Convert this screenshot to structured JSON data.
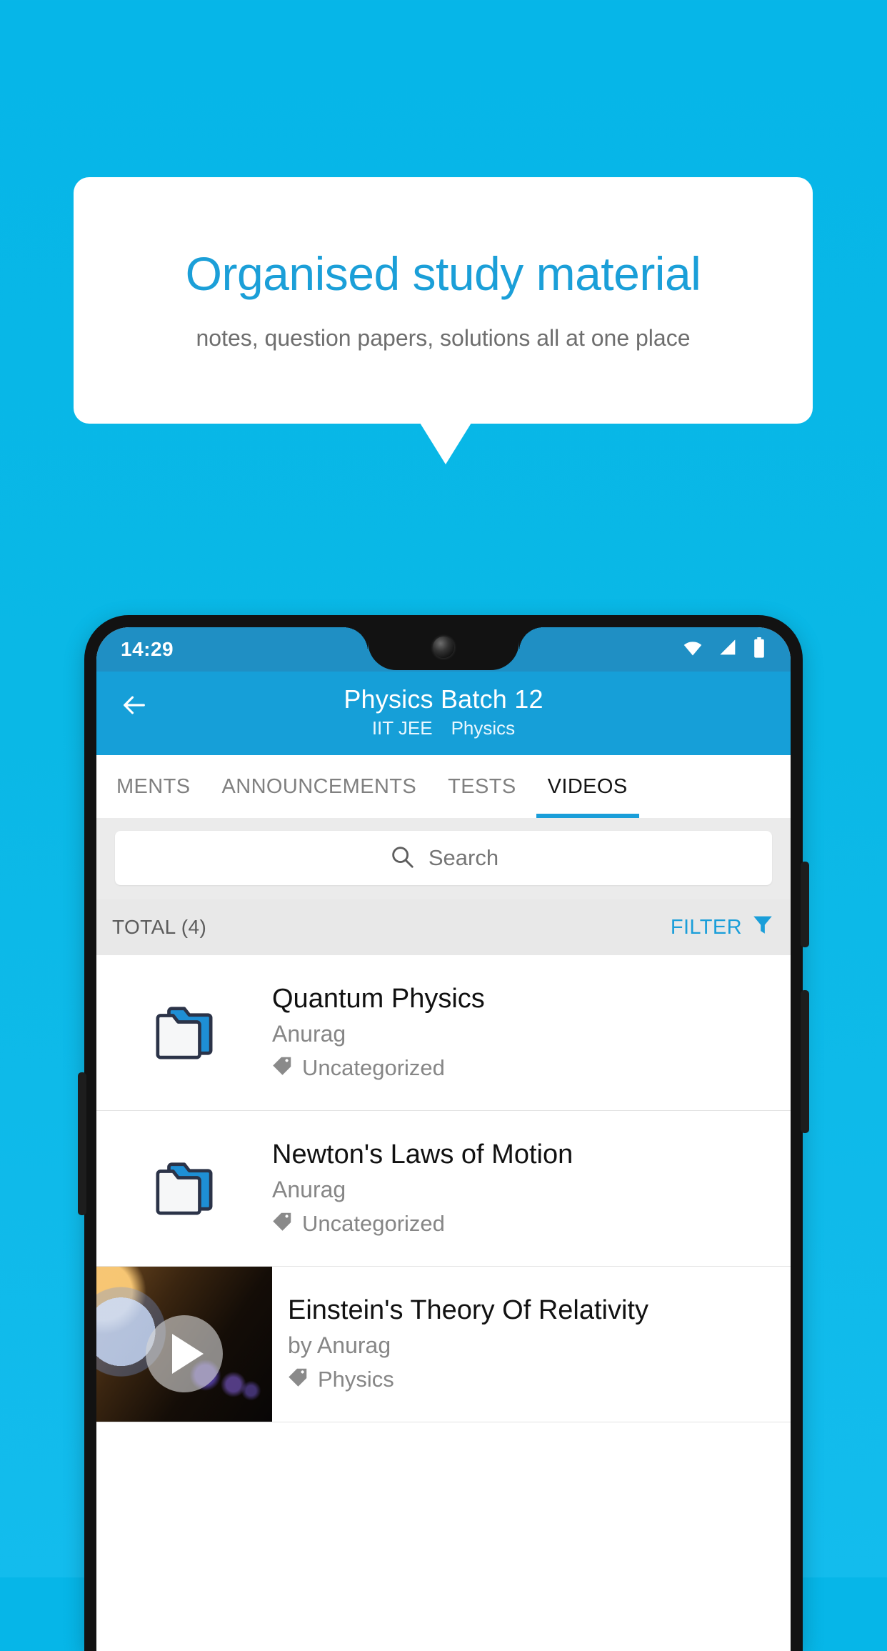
{
  "promo": {
    "title": "Organised study material",
    "subtitle": "notes, question papers, solutions all at one place",
    "accent_color": "#1b9fd8",
    "background_color": "#0ab8e6"
  },
  "phone": {
    "status_bar": {
      "time": "14:29",
      "icons": [
        "wifi-icon",
        "signal-icon",
        "battery-icon"
      ],
      "background_color": "#1f8fc4"
    },
    "app_bar": {
      "back_icon": "back-arrow-icon",
      "title": "Physics Batch 12",
      "subtitle_exam": "IIT JEE",
      "subtitle_subject": "Physics",
      "background_color": "#169fd8"
    },
    "tabs": [
      {
        "label": "MENTS",
        "active": false
      },
      {
        "label": "ANNOUNCEMENTS",
        "active": false
      },
      {
        "label": "TESTS",
        "active": false
      },
      {
        "label": "VIDEOS",
        "active": true
      }
    ],
    "search": {
      "icon": "search-icon",
      "placeholder": "Search",
      "value": ""
    },
    "toolbar": {
      "total_label": "TOTAL (4)",
      "filter_label": "FILTER",
      "filter_icon": "filter-funnel-icon",
      "filter_color": "#1a9ed9"
    },
    "list": [
      {
        "type": "folder",
        "icon": "folder-icon",
        "title": "Quantum Physics",
        "author": "Anurag",
        "tag_icon": "tag-icon",
        "tag": "Uncategorized"
      },
      {
        "type": "folder",
        "icon": "folder-icon",
        "title": "Newton's Laws of Motion",
        "author": "Anurag",
        "tag_icon": "tag-icon",
        "tag": "Uncategorized"
      },
      {
        "type": "video",
        "icon": "play-icon",
        "title": "Einstein's Theory Of Relativity",
        "author": "by Anurag",
        "tag_icon": "tag-icon",
        "tag": "Physics"
      }
    ]
  }
}
